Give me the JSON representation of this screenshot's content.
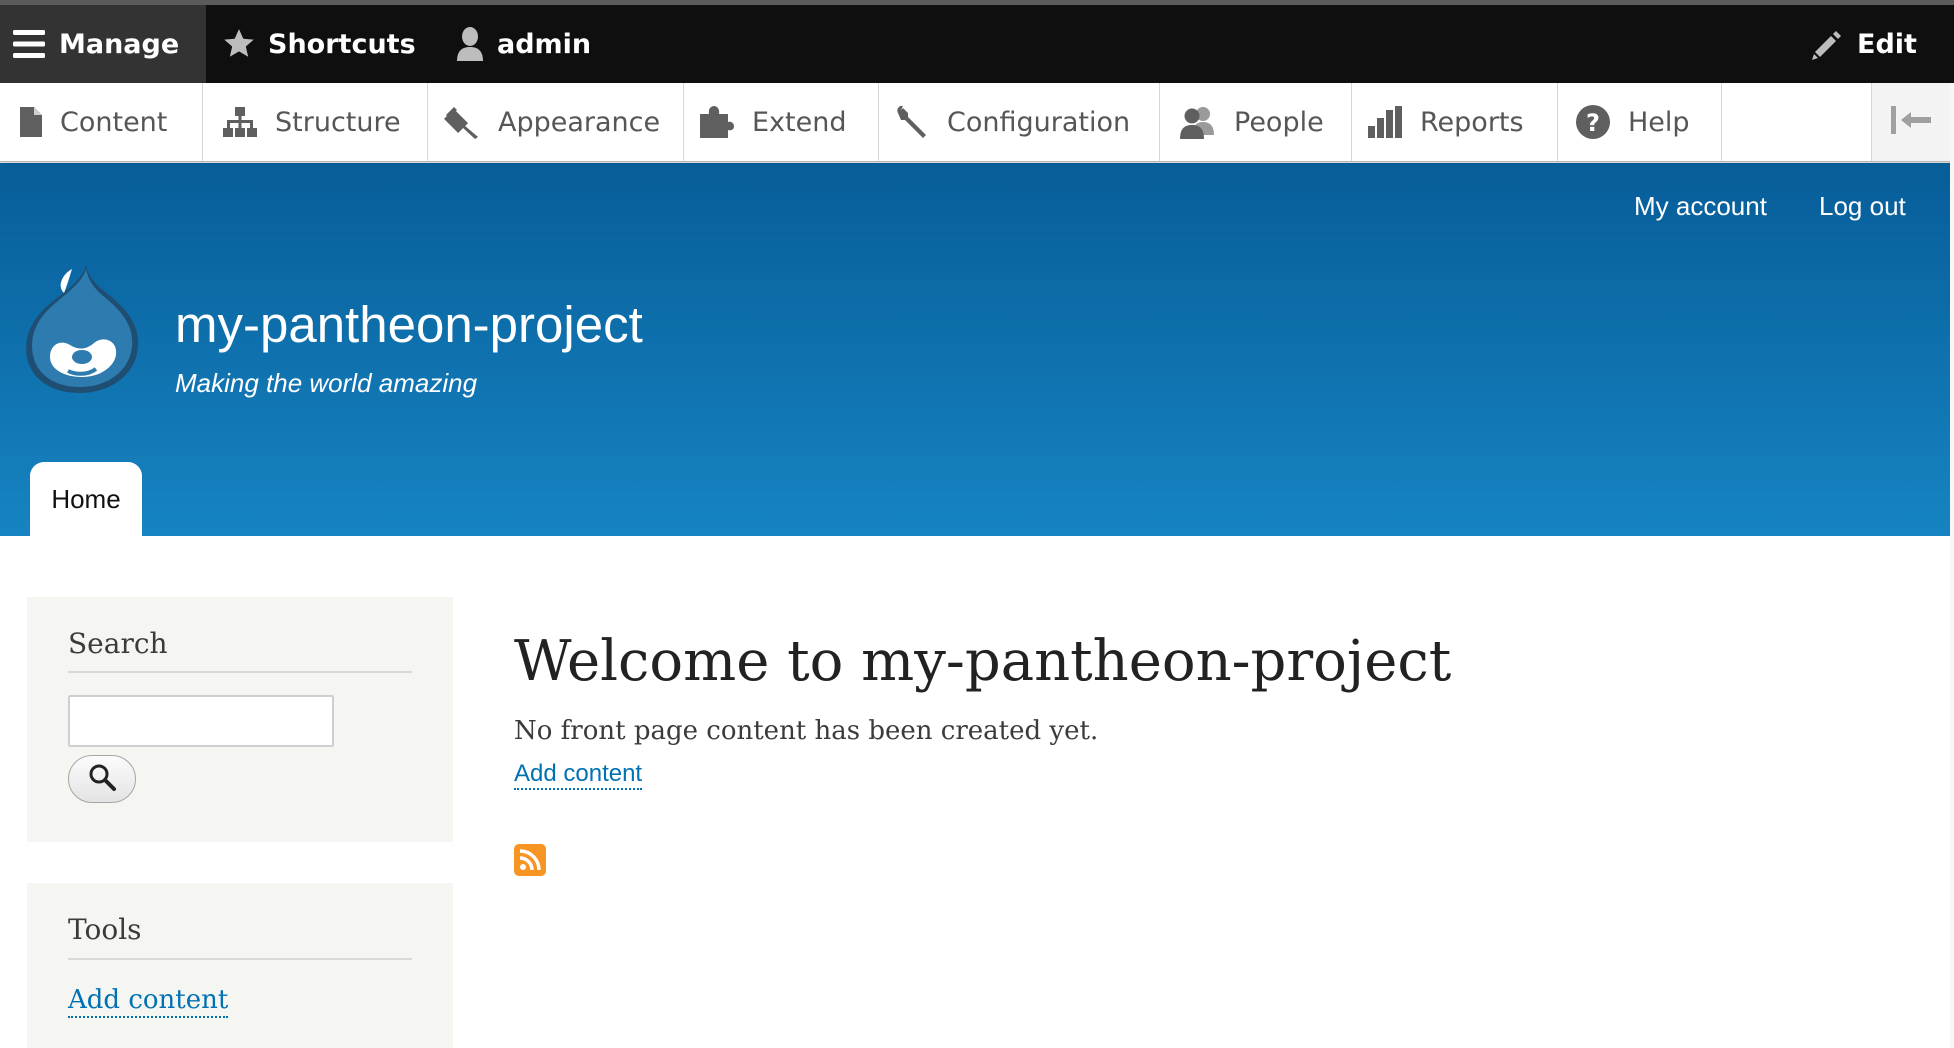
{
  "toolbar": {
    "manage": "Manage",
    "shortcuts": "Shortcuts",
    "user": "admin",
    "edit": "Edit"
  },
  "tray": {
    "items": [
      {
        "label": "Content",
        "icon": "file-icon"
      },
      {
        "label": "Structure",
        "icon": "sitemap-icon"
      },
      {
        "label": "Appearance",
        "icon": "paint-brush-icon"
      },
      {
        "label": "Extend",
        "icon": "puzzle-icon"
      },
      {
        "label": "Configuration",
        "icon": "wrench-icon"
      },
      {
        "label": "People",
        "icon": "people-icon"
      },
      {
        "label": "Reports",
        "icon": "bar-chart-icon"
      },
      {
        "label": "Help",
        "icon": "help-icon"
      }
    ],
    "collapse_icon": "collapse-arrow-icon"
  },
  "header": {
    "account_links": [
      "My account",
      "Log out"
    ],
    "site_name": "my-pantheon-project",
    "slogan": "Making the world amazing",
    "tabs": [
      "Home"
    ],
    "logo_icon": "drupal-drop-logo"
  },
  "sidebar": {
    "search": {
      "title": "Search",
      "input_value": "",
      "button_icon": "search-icon"
    },
    "tools": {
      "title": "Tools",
      "link": "Add content"
    }
  },
  "main": {
    "title": "Welcome to my-pantheon-project",
    "empty_text": "No front page content has been created yet.",
    "add_link": "Add content",
    "feed_icon": "rss-icon"
  },
  "colors": {
    "toolbar_bg": "#0f0f0f",
    "manage_bg": "#333333",
    "header_top": "#075d98",
    "header_bottom": "#1684c2",
    "link": "#0071b3",
    "rss": "#f79422"
  }
}
